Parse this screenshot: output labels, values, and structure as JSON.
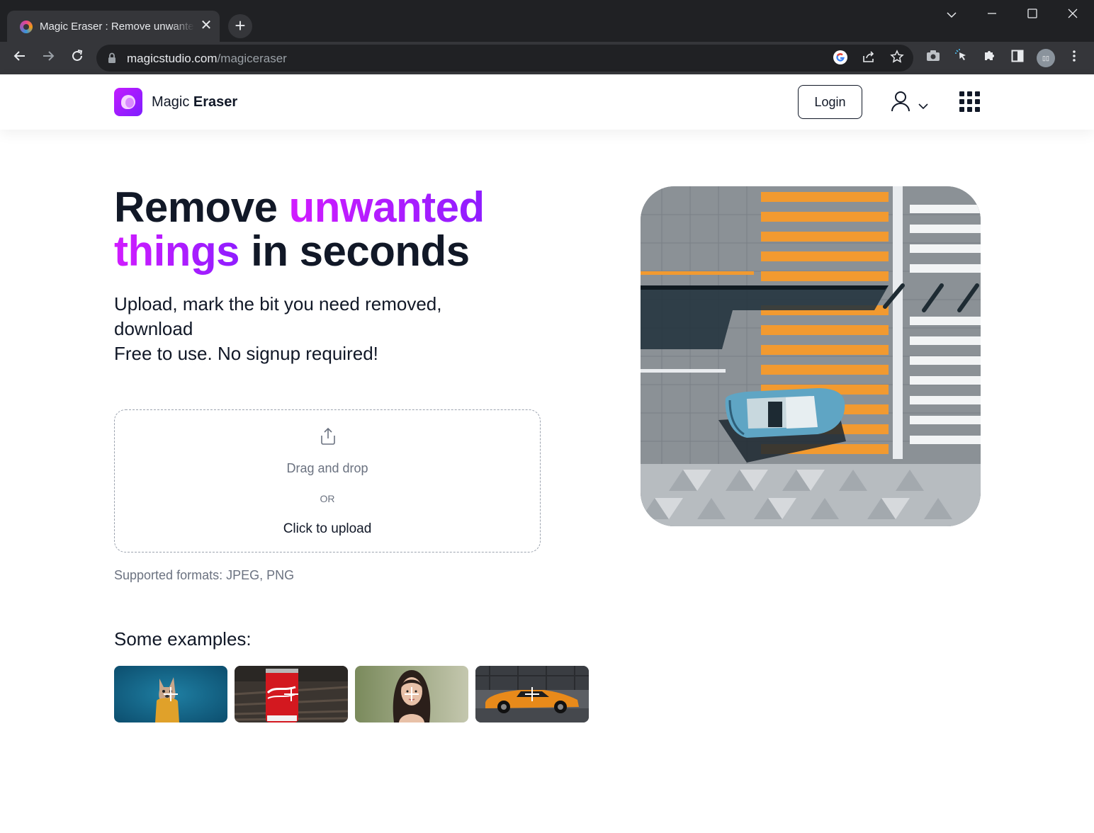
{
  "browser": {
    "tab_title": "Magic Eraser : Remove unwanted things in seconds",
    "url_domain": "magicstudio.com",
    "url_path": "/magiceraser",
    "tab_close_glyph": "✕",
    "new_tab_glyph": "+",
    "icons": [
      "favicon",
      "close-icon",
      "plus-icon",
      "chevron-down-icon",
      "minimize-icon",
      "maximize-icon",
      "window-close-icon",
      "back-arrow-icon",
      "forward-arrow-icon",
      "reload-icon",
      "lock-icon",
      "google-icon",
      "share-icon",
      "star-icon",
      "camera-icon",
      "cursor-icon",
      "puzzle-icon",
      "sidepanel-icon",
      "profile-avatar",
      "kebab-menu-icon"
    ]
  },
  "header": {
    "logo_word1": "Magic",
    "logo_word2": "Eraser",
    "login_label": "Login"
  },
  "hero": {
    "title_part1": "Remove ",
    "title_accent1": "unwanted",
    "title_accent2": "things",
    "title_part2": " in seconds",
    "subtitle_line1": "Upload, mark the bit you need removed, download",
    "subtitle_line2": "Free to use. No signup required!"
  },
  "upload": {
    "drag_text": "Drag and drop",
    "or_text": "OR",
    "click_text": "Click to upload",
    "formats_text": "Supported formats: JPEG, PNG"
  },
  "examples": {
    "title": "Some examples:",
    "items": [
      "dog-example",
      "cola-can-example",
      "woman-portrait-example",
      "orange-car-example"
    ]
  },
  "colors": {
    "accent_start": "#d11cff",
    "accent_end": "#8f1dff",
    "text": "#111827",
    "muted": "#6b7280",
    "chrome_dark": "#202124",
    "chrome_toolbar": "#35363a"
  }
}
